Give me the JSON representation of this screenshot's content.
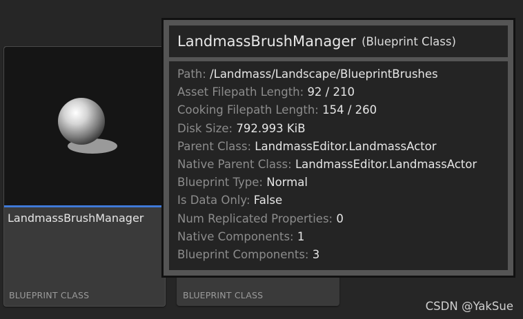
{
  "tiles": [
    {
      "name": "LandmassBrushManager",
      "type": "BLUEPRINT CLASS"
    },
    {
      "name": "",
      "type": "BLUEPRINT CLASS"
    }
  ],
  "tooltip": {
    "title": "LandmassBrushManager",
    "subtitle": "(Blueprint Class)",
    "rows": [
      {
        "key": "Path:",
        "value": "/Landmass/Landscape/BlueprintBrushes"
      },
      {
        "key": "Asset Filepath Length:",
        "value": "92 / 210"
      },
      {
        "key": "Cooking Filepath Length:",
        "value": "154 / 260"
      },
      {
        "key": "Disk Size:",
        "value": "792.993 KiB"
      },
      {
        "key": "Parent Class:",
        "value": "LandmassEditor.LandmassActor"
      },
      {
        "key": "Native Parent Class:",
        "value": "LandmassEditor.LandmassActor"
      },
      {
        "key": "Blueprint Type:",
        "value": "Normal"
      },
      {
        "key": "Is Data Only:",
        "value": "False"
      },
      {
        "key": "Num Replicated Properties:",
        "value": "0"
      },
      {
        "key": "Native Components:",
        "value": "1"
      },
      {
        "key": "Blueprint Components:",
        "value": "3"
      }
    ]
  },
  "watermark": "CSDN @YakSue",
  "colors": {
    "background": "#262626",
    "accent": "#3f7ad8",
    "tooltip_border": "#555555",
    "key_text": "#8c8c8c",
    "value_text": "#e6e6e6"
  },
  "icons": {
    "thumbnail": "sphere-icon"
  }
}
